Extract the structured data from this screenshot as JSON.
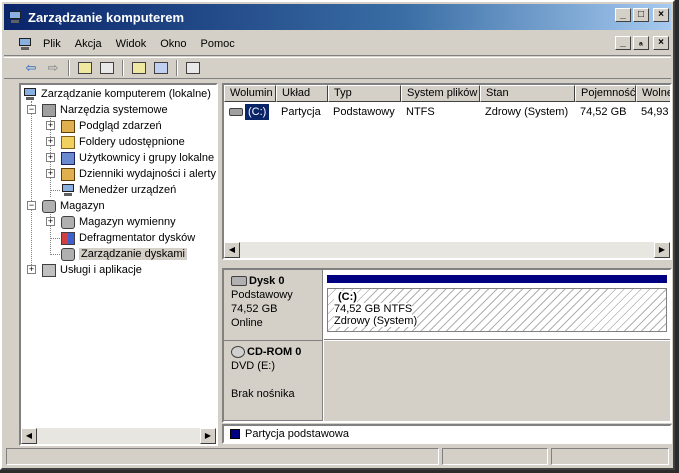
{
  "window": {
    "title": "Zarządzanie komputerem",
    "buttons": {
      "minimize": "_",
      "maximize": "□",
      "close": "×"
    }
  },
  "menu": {
    "items": [
      "Plik",
      "Akcja",
      "Widok",
      "Okno",
      "Pomoc"
    ]
  },
  "mdi": {
    "minimize": "_",
    "restore": "ₐ",
    "close": "×"
  },
  "toolbar": {
    "back": "⇦",
    "forward": "⇨"
  },
  "tree": {
    "root": "Zarządzanie komputerem (lokalne)",
    "system_tools": "Narzędzia systemowe",
    "event_viewer": "Podgląd zdarzeń",
    "shared_folders": "Foldery udostępnione",
    "local_users": "Użytkownicy i grupy lokalne",
    "perf_logs": "Dzienniki wydajności i alerty",
    "device_manager": "Menedżer urządzeń",
    "storage": "Magazyn",
    "removable_storage": "Magazyn wymienny",
    "defragmenter": "Defragmentator dysków",
    "disk_management": "Zarządzanie dyskami",
    "services": "Usługi i aplikacje",
    "expand_plus": "+",
    "expand_minus": "−"
  },
  "volume_list": {
    "headers": [
      "Wolumin",
      "Układ",
      "Typ",
      "System plików",
      "Stan",
      "Pojemność",
      "Wolne"
    ],
    "row": {
      "volume": "(C:)",
      "layout": "Partycja",
      "type": "Podstawowy",
      "fs": "NTFS",
      "status": "Zdrowy (System)",
      "capacity": "74,52 GB",
      "free": "54,93"
    }
  },
  "scroll": {
    "left": "◀",
    "right": "▶"
  },
  "disks": {
    "disk0": {
      "name": "Dysk 0",
      "type": "Podstawowy",
      "size": "74,52 GB",
      "status": "Online"
    },
    "partition": {
      "label": "(C:)",
      "size_fs": "74,52 GB NTFS",
      "status": "Zdrowy (System)"
    },
    "cdrom": {
      "name": "CD-ROM 0",
      "type": "DVD (E:)",
      "status": "Brak nośnika"
    }
  },
  "legend": {
    "primary_partition": "Partycja podstawowa",
    "color": "#000080"
  }
}
